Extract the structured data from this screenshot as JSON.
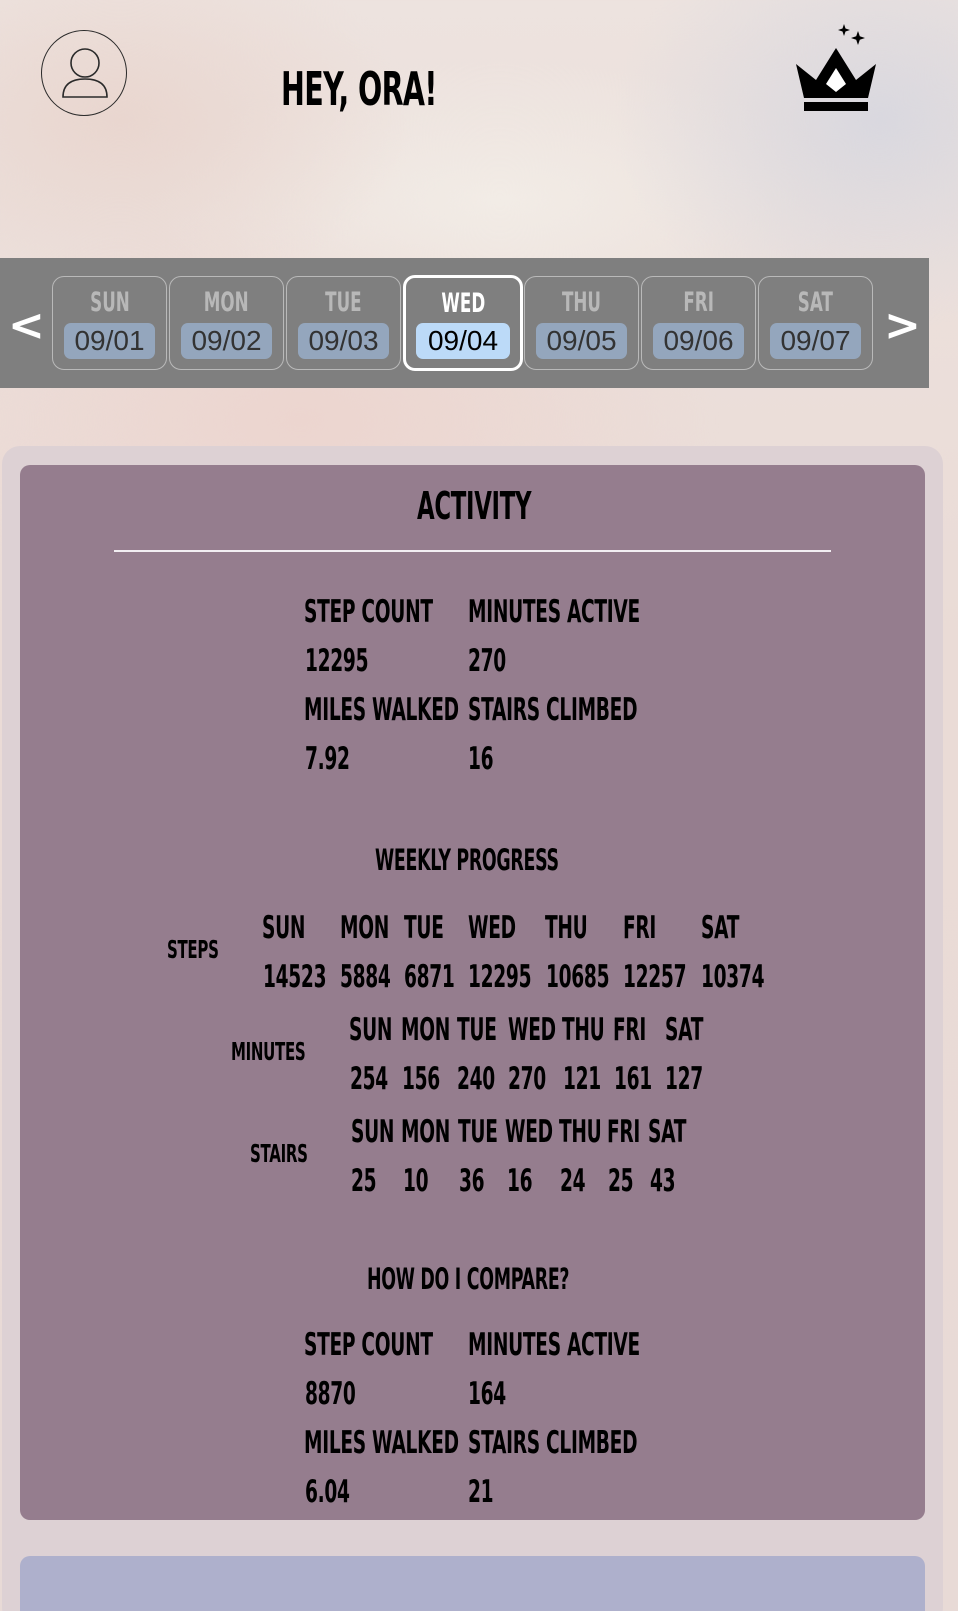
{
  "header": {
    "greeting": "HEY, ORA!",
    "avatar_icon": "user-icon",
    "crown_icon": "crown-icon"
  },
  "date_strip": {
    "prev": "<",
    "next": ">",
    "days": [
      {
        "name": "SUN",
        "date": "09/01"
      },
      {
        "name": "MON",
        "date": "09/02"
      },
      {
        "name": "TUE",
        "date": "09/03"
      },
      {
        "name": "WED",
        "date": "09/04"
      },
      {
        "name": "THU",
        "date": "09/05"
      },
      {
        "name": "FRI",
        "date": "09/06"
      },
      {
        "name": "SAT",
        "date": "09/07"
      }
    ],
    "selected": "WED"
  },
  "activity": {
    "title": "ACTIVITY",
    "step_count_label": "STEP COUNT",
    "step_count": "12295",
    "minutes_active_label": "MINUTES ACTIVE",
    "minutes_active": "270",
    "miles_walked_label": "MILES WALKED",
    "miles_walked": "7.92",
    "stairs_climbed_label": "STAIRS CLIMBED",
    "stairs_climbed": "16"
  },
  "weekly": {
    "title": "WEEKLY PROGRESS",
    "steps": {
      "label": "STEPS",
      "days": [
        "SUN",
        "MON",
        "TUE",
        "WED",
        "THU",
        "FRI",
        "SAT"
      ],
      "values": [
        "14523",
        "5884",
        "6871",
        "12295",
        "10685",
        "12257",
        "10374"
      ]
    },
    "minutes": {
      "label": "MINUTES",
      "days": [
        "SUN",
        "MON",
        "TUE",
        "WED",
        "THU",
        "FRI",
        "SAT"
      ],
      "values": [
        "254",
        "156",
        "240",
        "270",
        "121",
        "161",
        "127"
      ]
    },
    "stairs": {
      "label": "STAIRS",
      "days": [
        "SUN",
        "MON",
        "TUE",
        "WED",
        "THU",
        "FRI",
        "SAT"
      ],
      "values": [
        "25",
        "10",
        "36",
        "16",
        "24",
        "25",
        "43"
      ]
    }
  },
  "compare": {
    "title": "HOW DO I COMPARE?",
    "step_count_label": "STEP COUNT",
    "step_count": "8870",
    "minutes_active_label": "MINUTES ACTIVE",
    "minutes_active": "164",
    "miles_walked_label": "MILES WALKED",
    "miles_walked": "6.04",
    "stairs_climbed_label": "STAIRS CLIMBED",
    "stairs_climbed": "21"
  },
  "colors": {
    "card": "#957d8e",
    "strip": "#7f7f7f",
    "selected_date": "#bcdaf8",
    "date_pill": "#94a6bd"
  }
}
